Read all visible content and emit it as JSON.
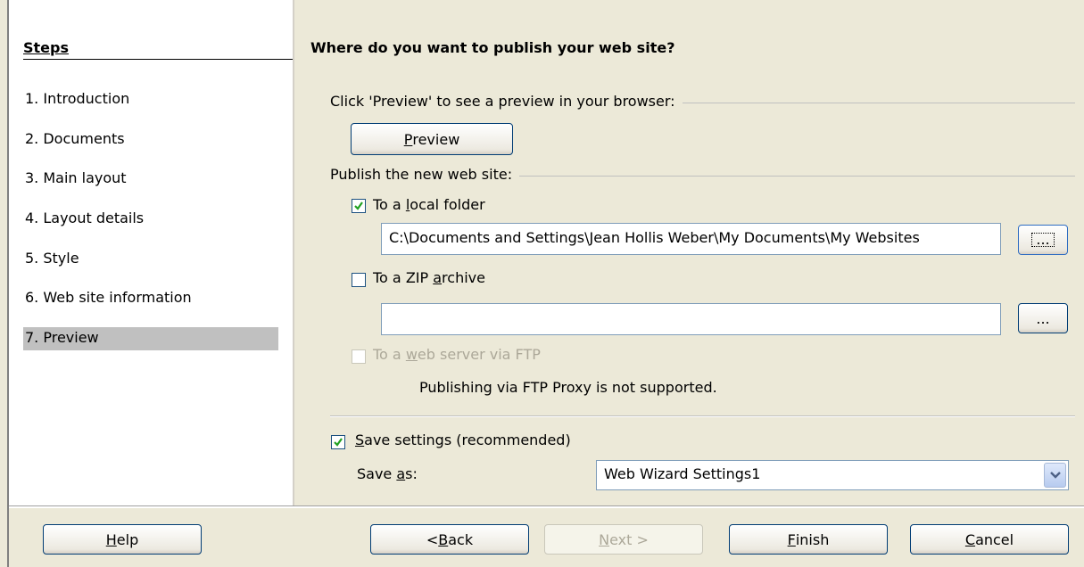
{
  "steps": {
    "title": "Steps",
    "items": [
      {
        "label": "1.  Introduction"
      },
      {
        "label": "2.  Documents"
      },
      {
        "label": "3.  Main layout"
      },
      {
        "label": "4.  Layout details"
      },
      {
        "label": "5.  Style"
      },
      {
        "label": "6.  Web site information"
      },
      {
        "label": "7.  Preview"
      }
    ],
    "selected_index": 6
  },
  "main": {
    "heading": "Where do you want to publish your web site?",
    "preview_group_label": "Click 'Preview' to see a preview in your browser:",
    "preview_button": {
      "pre": "",
      "accel": "P",
      "post": "review"
    },
    "publish_group_label": "Publish the new web site:",
    "local_folder": {
      "checked": true,
      "pre": "To a ",
      "accel": "l",
      "post": "ocal folder",
      "path": "C:\\Documents and Settings\\Jean Hollis Weber\\My Documents\\My Websites",
      "browse": "..."
    },
    "zip_archive": {
      "checked": false,
      "pre": "To a ZIP ",
      "accel": "a",
      "post": "rchive",
      "path": "",
      "browse": "..."
    },
    "ftp": {
      "checked": false,
      "enabled": false,
      "pre": "To a ",
      "accel": "w",
      "post": "eb server via FTP",
      "note": "Publishing via FTP Proxy is not supported."
    },
    "save_settings": {
      "checked": true,
      "pre": "",
      "accel": "S",
      "post": "ave settings (recommended)"
    },
    "save_as": {
      "pre": "Save ",
      "accel": "a",
      "post": "s:",
      "value": "Web Wizard Settings1"
    }
  },
  "footer": {
    "help": {
      "pre": "",
      "accel": "H",
      "post": "elp"
    },
    "back": {
      "pre": "< ",
      "accel": "B",
      "post": "ack"
    },
    "next": {
      "pre": "",
      "accel": "N",
      "post": "ext >"
    },
    "finish": {
      "pre": "",
      "accel": "F",
      "post": "inish"
    },
    "cancel": {
      "pre": "",
      "accel": "C",
      "post": "ancel"
    }
  }
}
